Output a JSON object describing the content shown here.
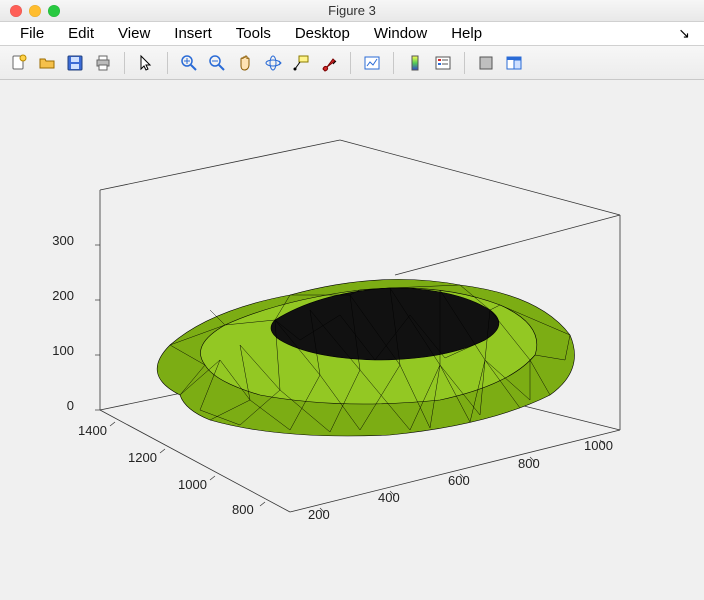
{
  "window": {
    "title": "Figure 3"
  },
  "menu": {
    "items": [
      "File",
      "Edit",
      "View",
      "Insert",
      "Tools",
      "Desktop",
      "Window",
      "Help"
    ],
    "overflow_glyph": "↘"
  },
  "toolbar": {
    "buttons": [
      {
        "name": "new-figure-button",
        "icon": "new-file-icon"
      },
      {
        "name": "open-button",
        "icon": "open-folder-icon"
      },
      {
        "name": "save-button",
        "icon": "save-disk-icon"
      },
      {
        "name": "print-button",
        "icon": "print-icon"
      },
      {
        "sep": true
      },
      {
        "name": "pointer-button",
        "icon": "pointer-icon"
      },
      {
        "sep": true
      },
      {
        "name": "zoom-in-button",
        "icon": "zoom-in-icon"
      },
      {
        "name": "zoom-out-button",
        "icon": "zoom-out-icon"
      },
      {
        "name": "pan-button",
        "icon": "pan-hand-icon"
      },
      {
        "name": "rotate-3d-button",
        "icon": "rotate-3d-icon"
      },
      {
        "name": "data-cursor-button",
        "icon": "data-cursor-icon"
      },
      {
        "name": "brush-button",
        "icon": "brush-icon"
      },
      {
        "sep": true
      },
      {
        "name": "link-plot-button",
        "icon": "link-icon"
      },
      {
        "sep": true
      },
      {
        "name": "colorbar-button",
        "icon": "colorbar-icon"
      },
      {
        "name": "legend-button",
        "icon": "legend-icon"
      },
      {
        "sep": true
      },
      {
        "name": "hide-tools-button",
        "icon": "hide-tools-icon"
      },
      {
        "name": "dock-button",
        "icon": "dock-icon"
      }
    ]
  },
  "chart_data": {
    "type": "surface-3d",
    "title": "",
    "x_axis": {
      "label": "",
      "ticks": [
        200,
        400,
        600,
        800,
        1000
      ],
      "range": [
        200,
        1000
      ]
    },
    "y_axis": {
      "label": "",
      "ticks": [
        800,
        1000,
        1200,
        1400
      ],
      "range": [
        800,
        1400
      ]
    },
    "z_axis": {
      "label": "",
      "ticks": [
        0,
        100,
        200,
        300
      ],
      "range": [
        0,
        300
      ]
    },
    "surface_color": "#8bc118",
    "edge_color": "#000000",
    "description": "triangulated 3D surface mesh (low mound / tumor-like blob) plotted with green faces and black wireframe edges"
  }
}
